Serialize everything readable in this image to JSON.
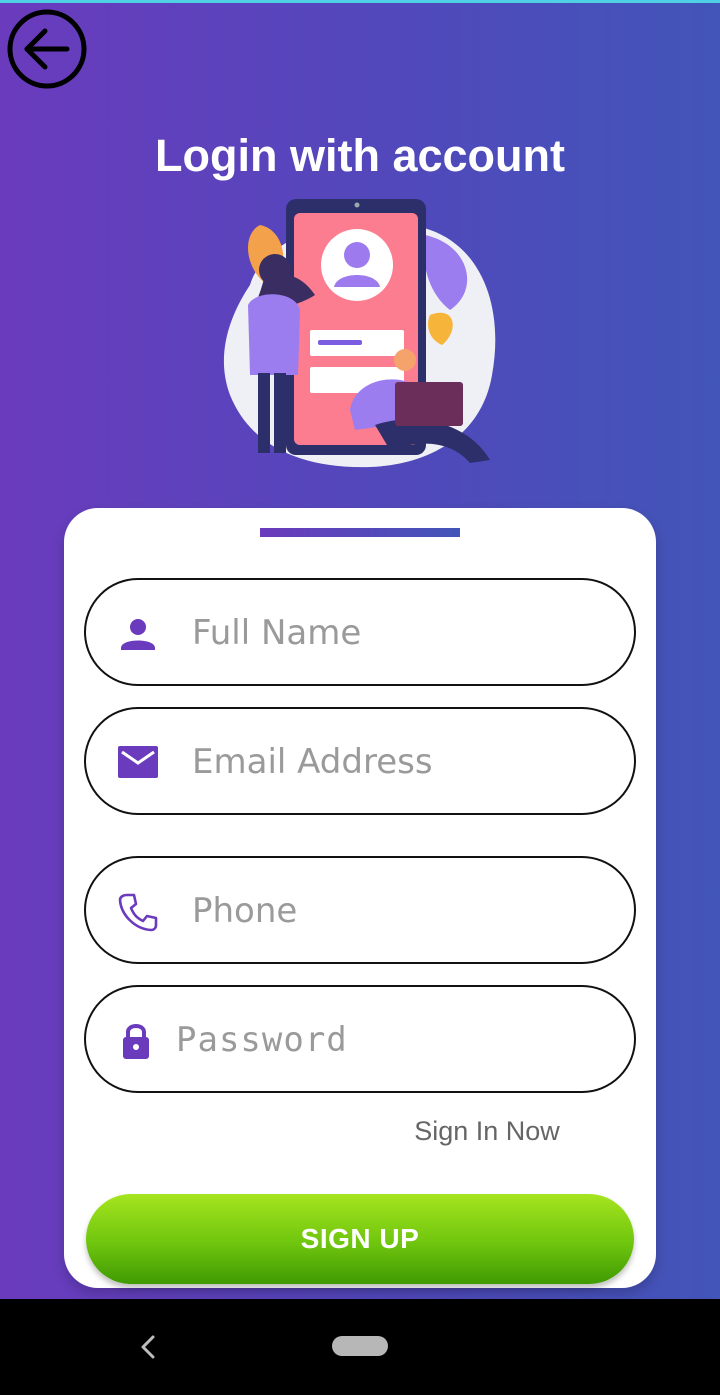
{
  "header": {
    "back_icon": "arrow-left-circle-icon",
    "title": "Login with account"
  },
  "form": {
    "full_name": {
      "placeholder": "Full Name",
      "value": "",
      "icon": "person-icon"
    },
    "email": {
      "placeholder": "Email Address",
      "value": "",
      "icon": "mail-icon"
    },
    "phone": {
      "placeholder": "Phone",
      "value": "",
      "icon": "phone-icon"
    },
    "password": {
      "placeholder": "Password",
      "value": "",
      "icon": "lock-icon"
    },
    "signin_link": "Sign In Now",
    "signup_label": "SIGN UP"
  },
  "colors": {
    "gradient_start": "#6a3bbd",
    "gradient_end": "#4255b8",
    "icon_purple": "#6a3bbd",
    "button_green": "#6fc50e"
  },
  "navbar": {
    "back_icon": "nav-back-icon",
    "home_icon": "nav-home-pill-icon"
  }
}
